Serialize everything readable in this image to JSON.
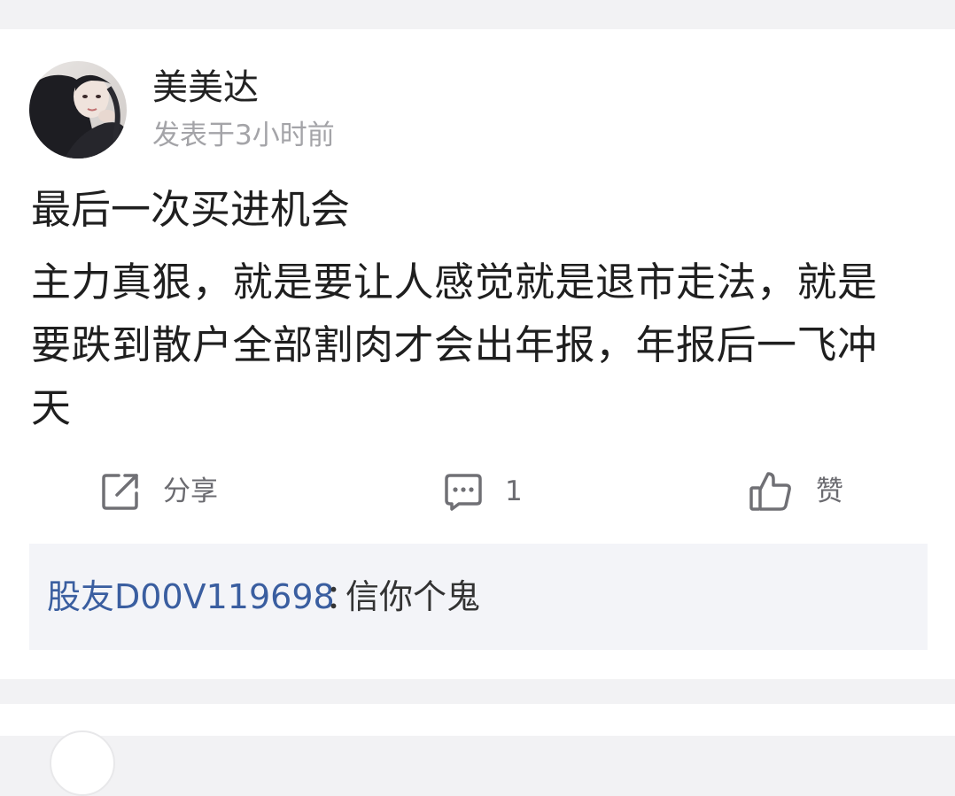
{
  "post": {
    "author": "美美达",
    "time": "发表于3小时前",
    "title": "最后一次买进机会",
    "body": "主力真狠，就是要让人感觉就是退市走法，就是要跌到散户全部割肉才会出年报，年报后一飞冲天"
  },
  "actions": {
    "share_label": "分享",
    "share_icon": "share-icon",
    "comment_count": "1",
    "comment_icon": "comment-icon",
    "like_label": "赞",
    "like_icon": "thumbs-up-icon"
  },
  "comment": {
    "author": "股友D00V119698",
    "separator": "：",
    "text": "信你个鬼"
  },
  "colors": {
    "page_bg": "#f2f2f4",
    "card_bg": "#ffffff",
    "comment_author": "#3a5ea0",
    "muted_text": "#a4a4a8"
  }
}
